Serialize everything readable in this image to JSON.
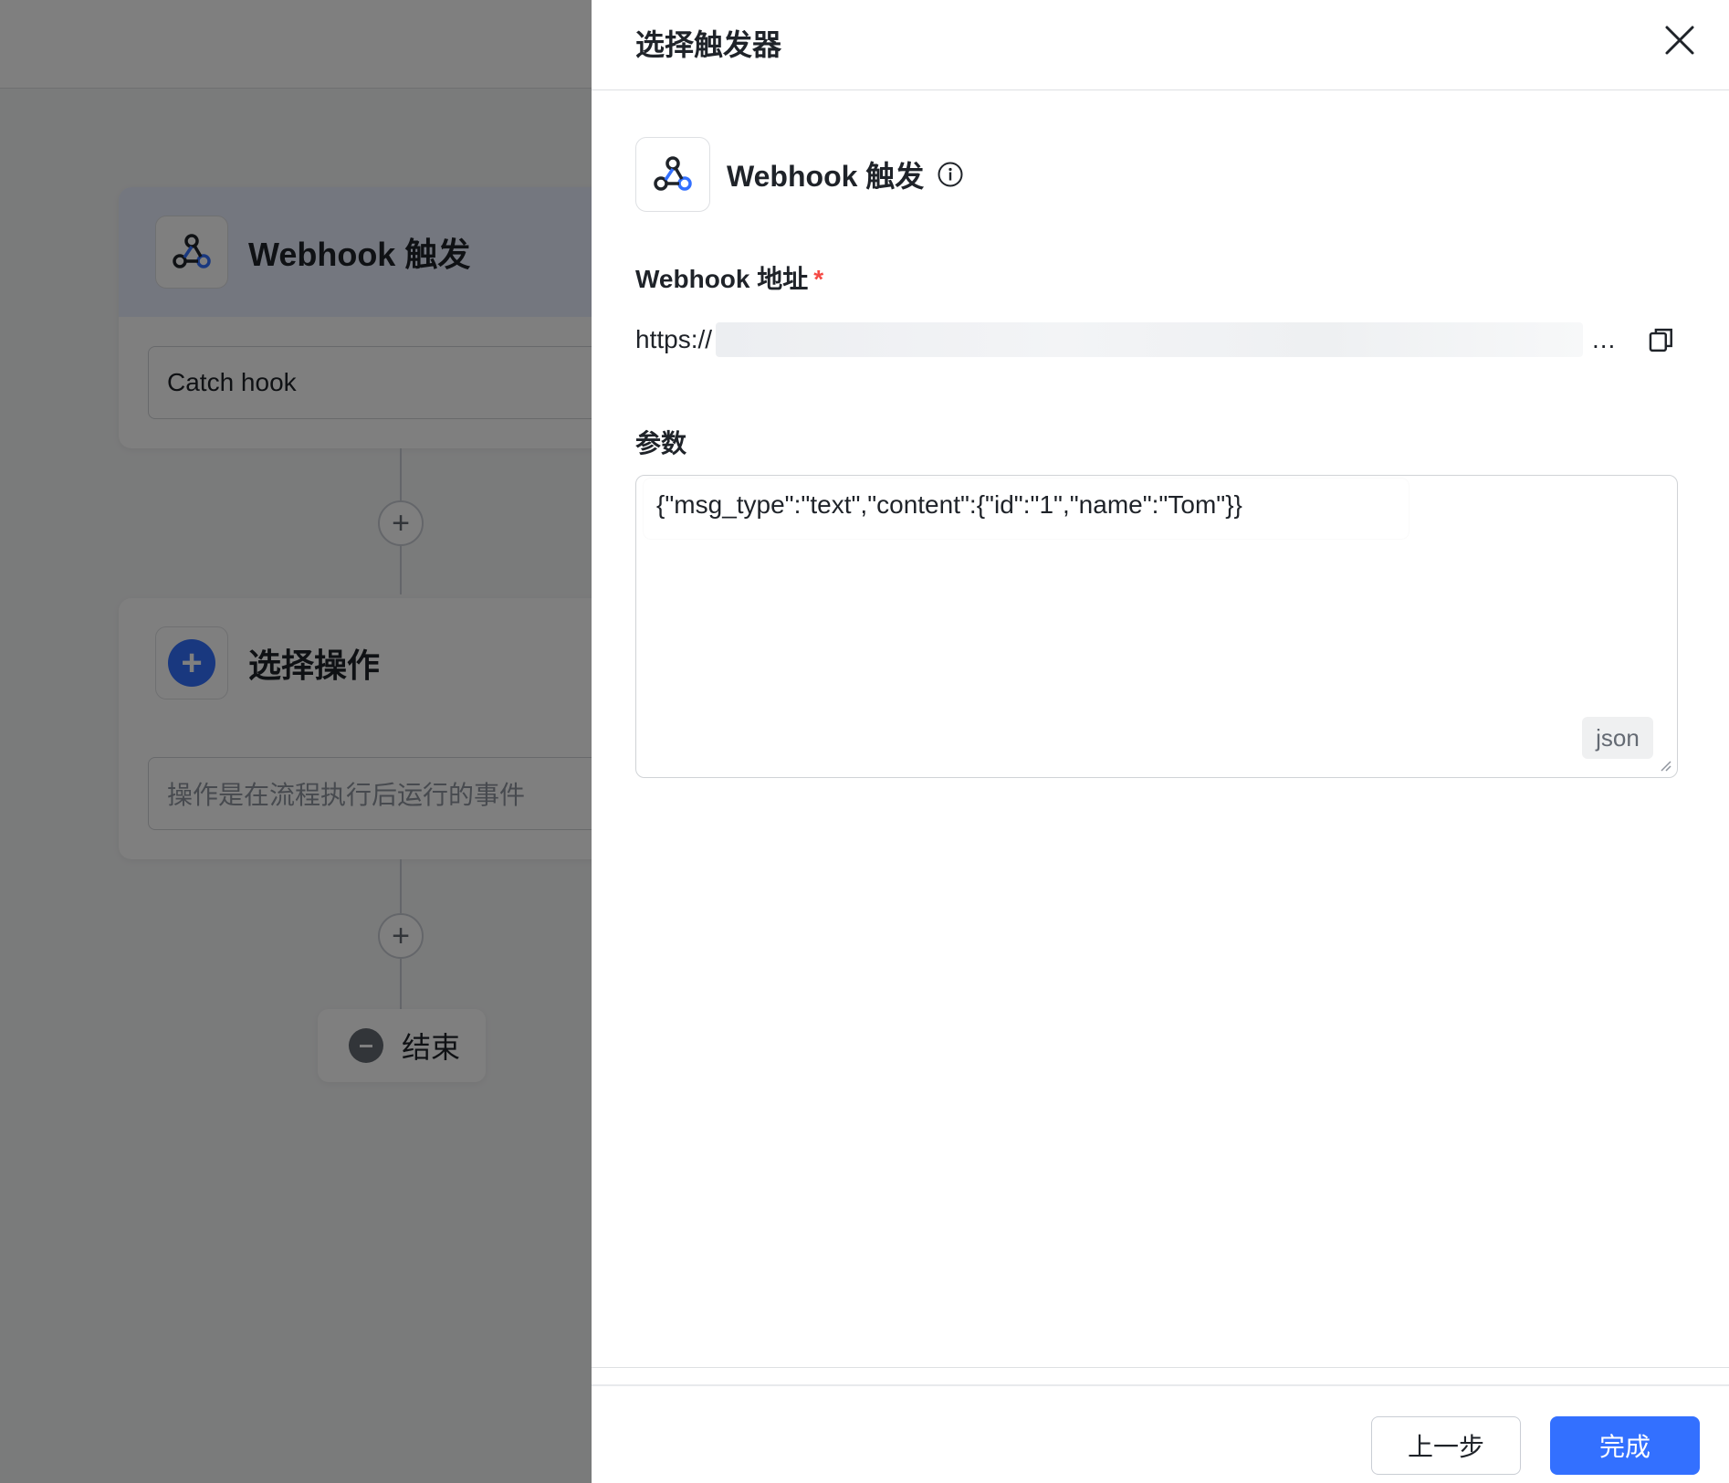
{
  "canvas": {
    "trigger_card": {
      "icon": "webhook-icon",
      "title": "Webhook 触发",
      "field_value": "Catch hook"
    },
    "action_card": {
      "icon": "plus-icon",
      "title": "选择操作",
      "field_placeholder": "操作是在流程执行后运行的事件"
    },
    "add_symbol": "+",
    "end_node": {
      "icon": "minus-circle-icon",
      "label": "结束"
    }
  },
  "drawer": {
    "title": "选择触发器",
    "close_icon": "close-icon",
    "trigger": {
      "icon": "webhook-icon",
      "title": "Webhook 触发",
      "info_icon": "info-icon"
    },
    "webhook_address": {
      "label": "Webhook 地址",
      "required_mark": "*",
      "url_prefix": "https://",
      "more": "...",
      "copy_icon": "copy-icon"
    },
    "params": {
      "label": "参数",
      "value": "{\"msg_type\":\"text\",\"content\":{\"id\":\"1\",\"name\":\"Tom\"}}",
      "format_badge": "json"
    },
    "footer": {
      "prev_label": "上一步",
      "done_label": "完成"
    }
  },
  "colors": {
    "accent": "#3370ff",
    "required": "#f54a45",
    "mask": "rgba(0,0,0,0.5)"
  }
}
